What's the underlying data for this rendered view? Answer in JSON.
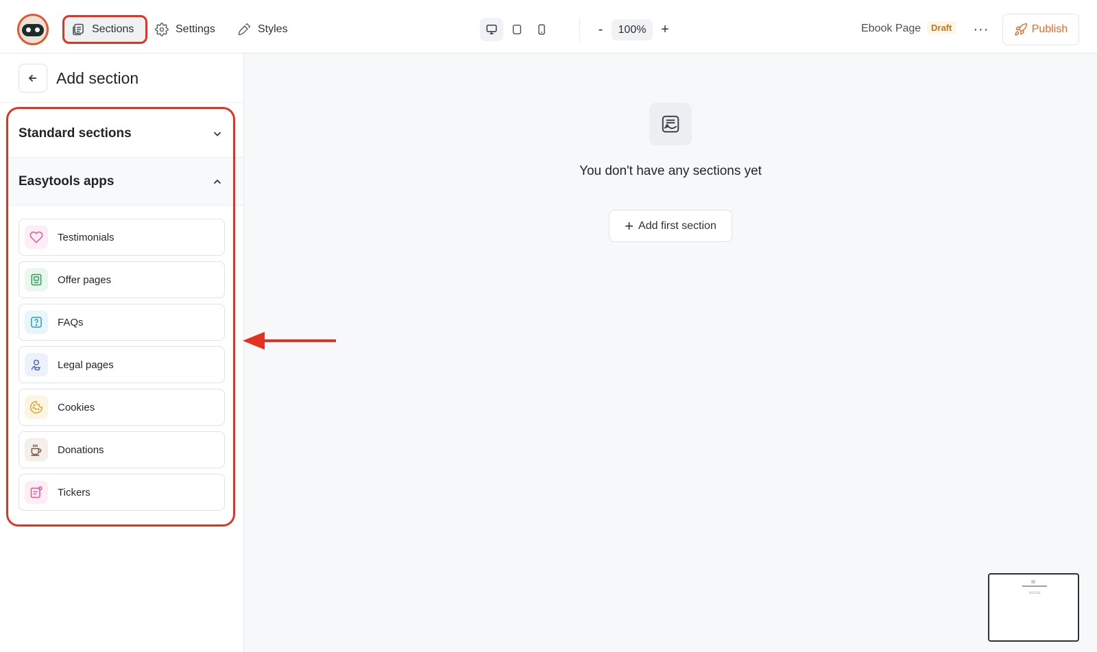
{
  "topbar": {
    "nav": {
      "sections_label": "Sections",
      "settings_label": "Settings",
      "styles_label": "Styles"
    },
    "zoom": {
      "minus_label": "-",
      "value": "100%",
      "plus_label": "+"
    },
    "page_name": "Ebook Page",
    "status_badge": "Draft",
    "more_label": "···",
    "publish_label": "Publish"
  },
  "sidebar": {
    "title": "Add section",
    "groups": [
      {
        "label": "Standard sections",
        "expanded": false
      },
      {
        "label": "Easytools apps",
        "expanded": true
      }
    ],
    "apps": [
      {
        "label": "Testimonials",
        "icon": "heart-icon",
        "color": "#e0559a",
        "bg": "#fdeef5"
      },
      {
        "label": "Offer pages",
        "icon": "offer-page-icon",
        "color": "#2e9d5b",
        "bg": "#e9f7ee"
      },
      {
        "label": "FAQs",
        "icon": "question-icon",
        "color": "#2b9cc5",
        "bg": "#e8f6fb"
      },
      {
        "label": "Legal pages",
        "icon": "legal-user-icon",
        "color": "#4a68b8",
        "bg": "#edf1fb"
      },
      {
        "label": "Cookies",
        "icon": "cookie-icon",
        "color": "#e0a42a",
        "bg": "#fdf5e3"
      },
      {
        "label": "Donations",
        "icon": "coffee-cup-icon",
        "color": "#7a5842",
        "bg": "#f5efeb"
      },
      {
        "label": "Tickers",
        "icon": "ticker-icon",
        "color": "#e0559a",
        "bg": "#fdeef5"
      }
    ]
  },
  "canvas": {
    "empty_message": "You don't have any sections yet",
    "add_first_label": "Add first section",
    "add_first_plus": "+"
  },
  "colors": {
    "accent": "#e46a23",
    "annotation": "#e5311f"
  }
}
